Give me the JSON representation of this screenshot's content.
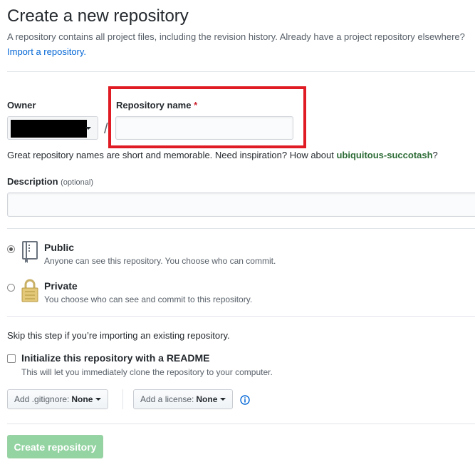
{
  "header": {
    "title": "Create a new repository",
    "subtitle": "A repository contains all project files, including the revision history. Already have a project repository elsewhere?",
    "import_link": "Import a repository."
  },
  "owner": {
    "label": "Owner",
    "value": ""
  },
  "repo_name": {
    "label": "Repository name",
    "required_mark": "*",
    "value": "",
    "placeholder": ""
  },
  "suggestion": {
    "text": "Great repository names are short and memorable. Need inspiration? How about",
    "name": "ubiquitous-succotash",
    "suffix": "?"
  },
  "description": {
    "label": "Description",
    "optional": "(optional)",
    "value": ""
  },
  "visibility": {
    "public": {
      "label": "Public",
      "note": "Anyone can see this repository. You choose who can commit.",
      "checked": true
    },
    "private": {
      "label": "Private",
      "note": "You choose who can see and commit to this repository.",
      "checked": false
    }
  },
  "init": {
    "skip_text": "Skip this step if you’re importing an existing repository.",
    "readme_label": "Initialize this repository with a README",
    "readme_note": "This will let you immediately clone the repository to your computer.",
    "readme_checked": false
  },
  "gitignore": {
    "prefix": "Add .gitignore:",
    "value": "None"
  },
  "license": {
    "prefix": "Add a license:",
    "value": "None"
  },
  "icons": {
    "repo": "repo-book-icon",
    "lock": "lock-icon",
    "info": "info-icon"
  },
  "submit": {
    "label": "Create repository"
  },
  "colors": {
    "highlight": "#e01b24",
    "create_button": "#94d3a2",
    "link": "#0366d6",
    "suggestion": "#2c6b35"
  }
}
